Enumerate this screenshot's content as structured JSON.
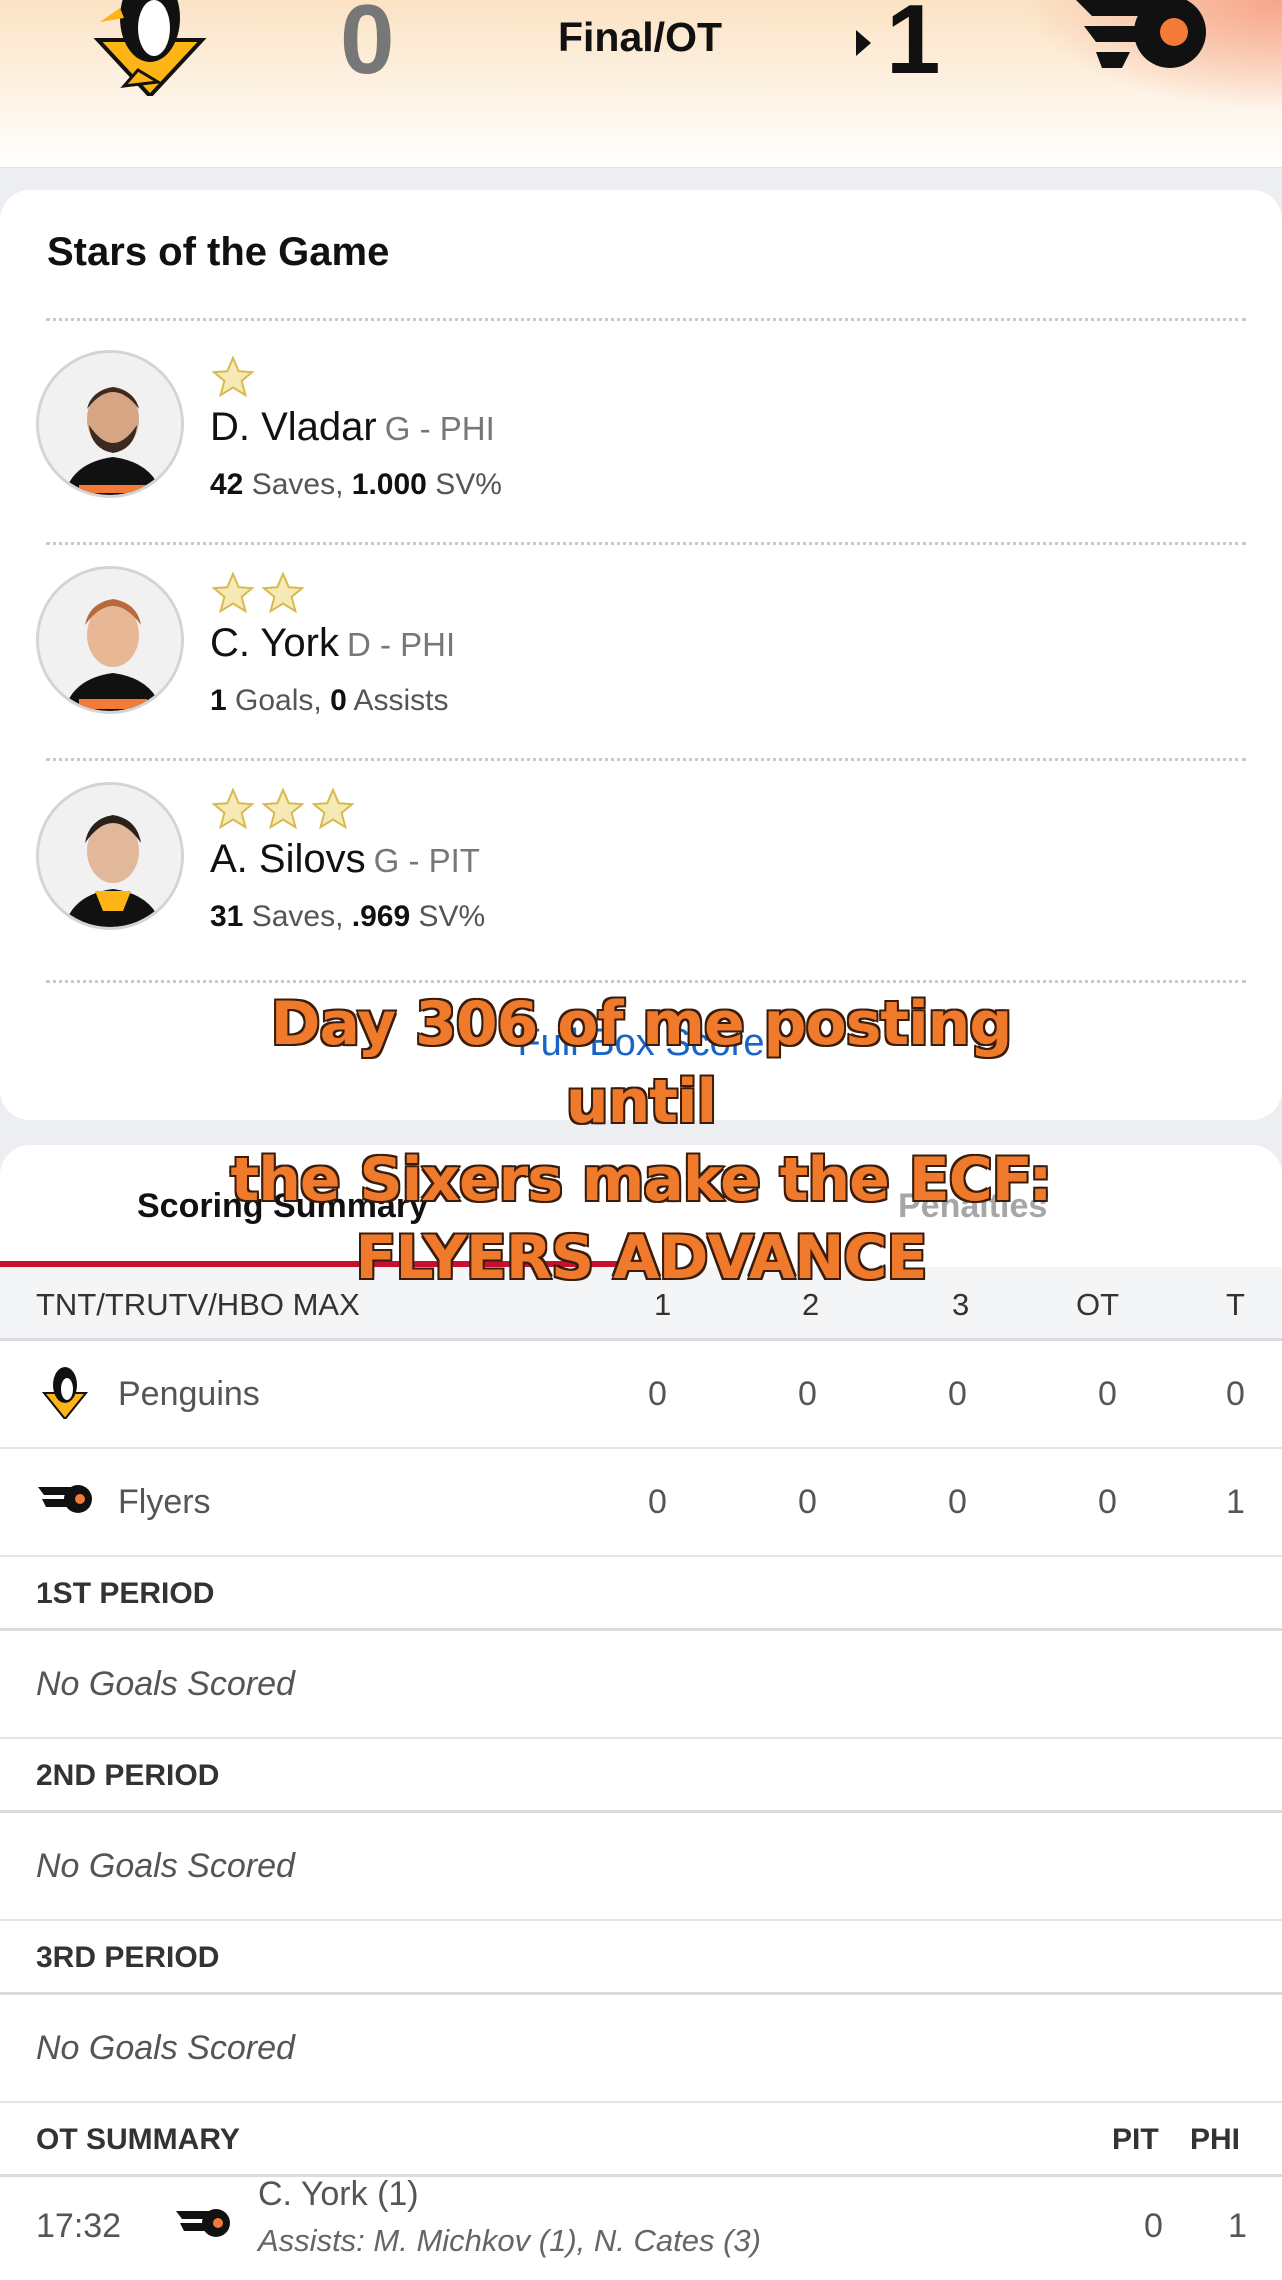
{
  "header": {
    "away_team": "Penguins",
    "home_team": "Flyers",
    "away_score": "0",
    "home_score": "1",
    "status": "Final/OT"
  },
  "stars_of_game": {
    "title": "Stars of the Game",
    "players": [
      {
        "stars": 1,
        "name": "D. Vladar",
        "position": "G - PHI",
        "stat1_value": "42",
        "stat1_label": "Saves,",
        "stat2_value": "1.000",
        "stat2_label": "SV%"
      },
      {
        "stars": 2,
        "name": "C. York",
        "position": "D - PHI",
        "stat1_value": "1",
        "stat1_label": "Goals,",
        "stat2_value": "0",
        "stat2_label": "Assists"
      },
      {
        "stars": 3,
        "name": "A. Silovs",
        "position": "G - PIT",
        "stat1_value": "31",
        "stat1_label": "Saves,",
        "stat2_value": ".969",
        "stat2_label": "SV%"
      }
    ],
    "box_score_link": "Full Box Score"
  },
  "tabs": {
    "scoring": "Scoring Summary",
    "penalties": "Penalties"
  },
  "linescore": {
    "broadcast": "TNT/TRUTV/HBO MAX",
    "periods": [
      "1",
      "2",
      "3",
      "OT",
      "T"
    ],
    "rows": [
      {
        "team": "Penguins",
        "values": [
          "0",
          "0",
          "0",
          "0",
          "0"
        ]
      },
      {
        "team": "Flyers",
        "values": [
          "0",
          "0",
          "0",
          "0",
          "1"
        ]
      }
    ]
  },
  "periods": [
    {
      "label": "1ST PERIOD",
      "text": "No Goals Scored"
    },
    {
      "label": "2ND PERIOD",
      "text": "No Goals Scored"
    },
    {
      "label": "3RD PERIOD",
      "text": "No Goals Scored"
    }
  ],
  "ot_summary": {
    "label": "OT SUMMARY",
    "col_away": "PIT",
    "col_home": "PHI",
    "goal": {
      "time": "17:32",
      "scorer": "C. York (1)",
      "assists": "Assists: M. Michkov (1), N. Cates (3)",
      "pit": "0",
      "phi": "1"
    }
  },
  "caption": {
    "line1": "Day 306 of me posting until",
    "line2": "the Sixers make the ECF:",
    "line3": "FLYERS ADVANCE"
  },
  "colors": {
    "accent_red": "#c8102e",
    "link_blue": "#1a63c8",
    "caption_orange": "#f07a2c",
    "star_gold": "#f3e3a0"
  },
  "icons": [
    "penguins-logo-icon",
    "flyers-logo-icon",
    "star-icon",
    "play-arrow-icon"
  ]
}
